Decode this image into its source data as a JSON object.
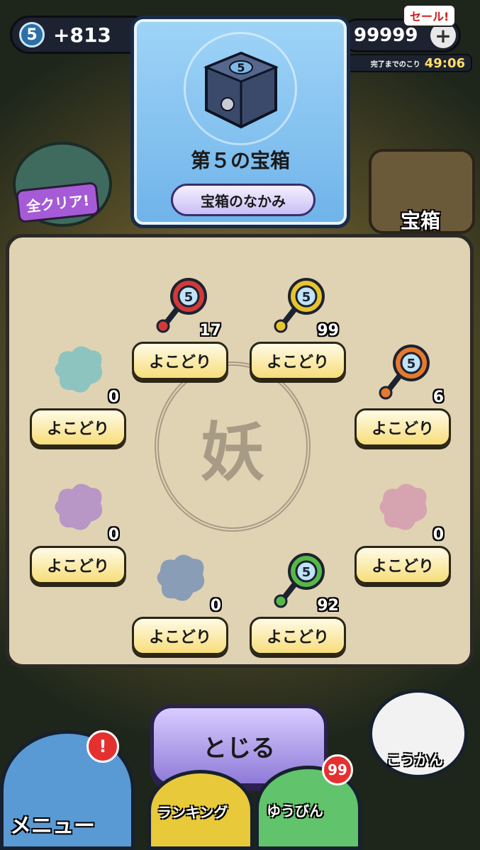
{
  "hud": {
    "level": "5",
    "points": "+813",
    "currency": "99999",
    "sale_label": "セール!",
    "timer_label": "完了までのこり",
    "timer_value": "49:06"
  },
  "side": {
    "all_clear_label": "全クリア!",
    "chest_label": "宝箱"
  },
  "chest": {
    "number": "5",
    "title": "第５の宝箱",
    "contents_button": "宝箱のなかみ"
  },
  "board": {
    "emblem_glyph": "妖",
    "slots": [
      {
        "count": "17",
        "button": "よこどり",
        "color": "#d23a3a",
        "has_key": true
      },
      {
        "count": "99",
        "button": "よこどり",
        "color": "#e8c52e",
        "has_key": true
      },
      {
        "count": "0",
        "button": "よこどり",
        "color": "#8ec4c0",
        "has_key": false
      },
      {
        "count": "6",
        "button": "よこどり",
        "color": "#e57a2e",
        "has_key": true
      },
      {
        "count": "0",
        "button": "よこどり",
        "color": "#b896c6",
        "has_key": false
      },
      {
        "count": "0",
        "button": "よこどり",
        "color": "#d6a4b0",
        "has_key": false
      },
      {
        "count": "0",
        "button": "よこどり",
        "color": "#8a9db6",
        "has_key": false
      },
      {
        "count": "92",
        "button": "よこどり",
        "color": "#55b847",
        "has_key": true
      }
    ]
  },
  "bottom": {
    "close_label": "とじる",
    "menu_label": "メニュー",
    "menu_alert": "!",
    "ranking_label": "ランキング",
    "mail_label": "ゆうびん",
    "mail_count": "99",
    "trade_label": "こうかん"
  }
}
